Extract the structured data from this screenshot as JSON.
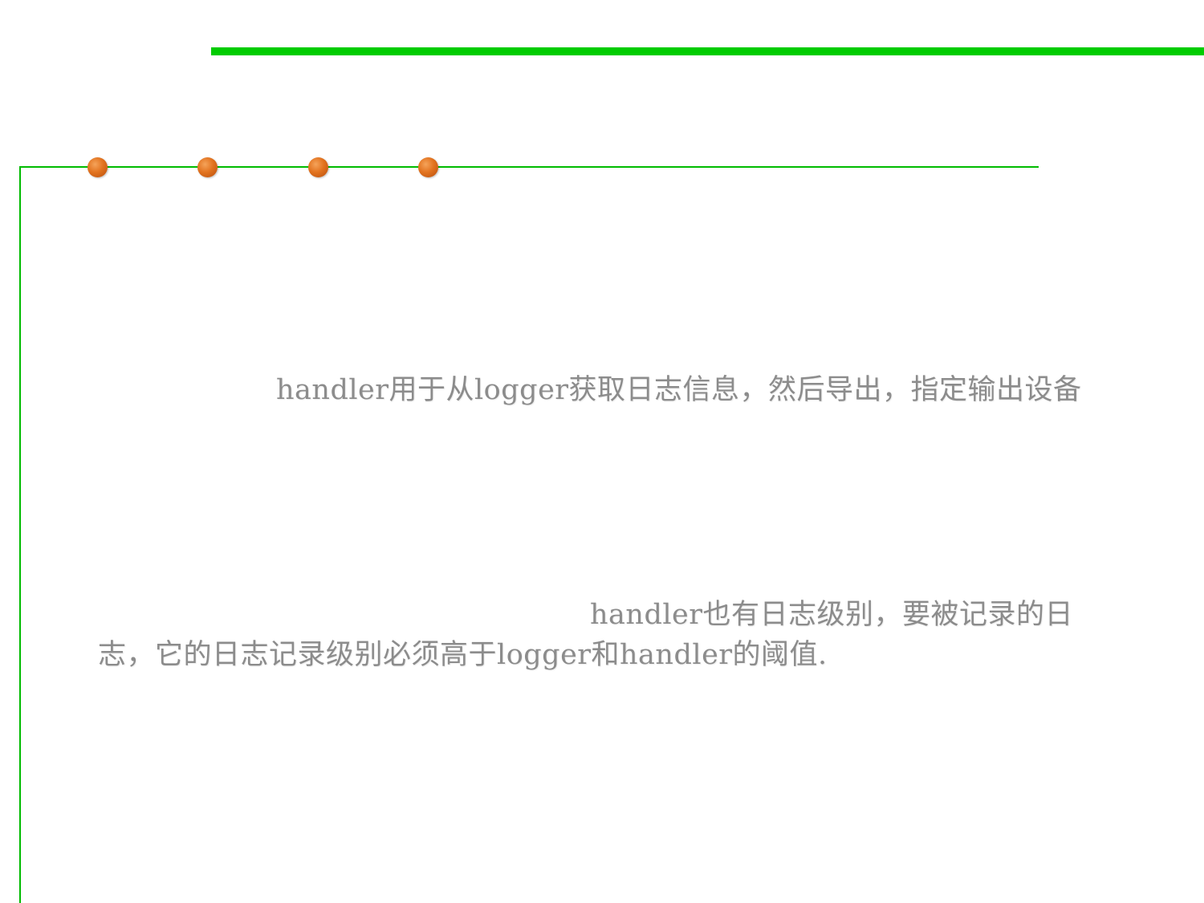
{
  "slide": {
    "paragraph_1": "handler用于从logger获取日志信息，然后导出，指定输出设备",
    "paragraph_2_line_1": "handler也有日志级别，要被记录的日",
    "paragraph_2_line_2": "志，它的日志记录级别必须高于logger和handler的阈值."
  },
  "colors": {
    "accent_green": "#00cc00",
    "bullet_orange": "#e2731f",
    "text_gray": "#8c8c8c"
  }
}
